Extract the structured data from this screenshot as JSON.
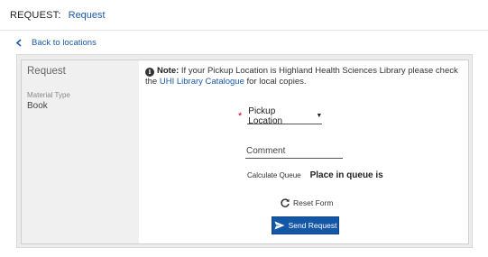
{
  "header": {
    "request_label": "REQUEST:",
    "request_link": "Request"
  },
  "back": {
    "label": "Back to locations",
    "icon": "chevron-left-icon"
  },
  "side": {
    "title": "Request",
    "material_type_label": "Material Type",
    "material_type_value": "Book"
  },
  "note": {
    "icon": "info-icon",
    "bold": "Note:",
    "text_before": " If your Pickup Location is Highland Health Sciences Library please check the ",
    "link_text": "UHI Library Catalogue",
    "text_after": " for local copies."
  },
  "form": {
    "required_marker": "*",
    "pickup_location_label": "Pickup Location",
    "comment_placeholder": "Comment",
    "calculate_queue_label": "Calculate Queue",
    "place_in_queue_label": "Place in queue is",
    "reset_label": "Reset Form",
    "send_label": "Send Request"
  },
  "colors": {
    "link": "#1a5aa8",
    "primary_button": "#1357a6",
    "required": "#d0021b"
  }
}
